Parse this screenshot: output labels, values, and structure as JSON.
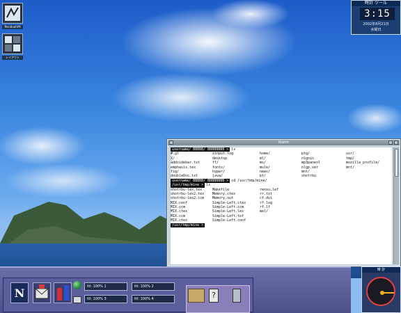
{
  "desktop": {
    "pager_icon_label": "ResidualVM",
    "layout_icon_label": "レイアウト"
  },
  "clock": {
    "title": "時計 ツール",
    "time": "3:15",
    "date": "2002年8月21日",
    "day": "水曜日"
  },
  "terminal": {
    "title": "kterm",
    "lines": [
      {
        "prompt": "username/ BBBBB/ BBBBBBBB >",
        "cmd": "ls",
        "cells": []
      },
      {
        "prompt": "",
        "cmd": "",
        "cells": [
          "#.gl",
          "xinput.log",
          "home/",
          "ptg/",
          "usr/"
        ]
      },
      {
        "prompt": "",
        "cmd": "",
        "cells": [
          "X/",
          "desktop",
          "ml/",
          "nlgnin",
          "tmp/"
        ]
      },
      {
        "prompt": "",
        "cmd": "",
        "cells": [
          "addsidebar.txt",
          "ff/",
          "ms/",
          "mp3paneol",
          "mozilla_profile/"
        ]
      },
      {
        "prompt": "",
        "cmd": "",
        "cells": [
          "emphasis.tex",
          "fonts/",
          "mule/",
          "nlgp.ver",
          "mnt/"
        ]
      },
      {
        "prompt": "",
        "cmd": "",
        "cells": [
          "fig/",
          "hyper/",
          "news/",
          "mnt/",
          ""
        ]
      },
      {
        "prompt": "",
        "cmd": "",
        "cells": [
          "doubleDoc.txt",
          "java/",
          "pt/",
          "shotrbu",
          ""
        ]
      },
      {
        "prompt": "username/ BBBBB/ BBBBBBBB >",
        "cmd": "cd /usr/tmp/mine/",
        "cells": []
      },
      {
        "prompt": "/usr/tmp/mine >",
        "cmd": "ls",
        "cells": []
      },
      {
        "prompt": "",
        "cmd": "",
        "cells": [
          "shotrbu-lex.tex",
          "Makefile",
          "rensu.lef",
          ""
        ]
      },
      {
        "prompt": "",
        "cmd": "",
        "cells": [
          "shotrbu-lex2.tex",
          "Memory.ctex",
          "rr.txt",
          ""
        ]
      },
      {
        "prompt": "",
        "cmd": "",
        "cells": [
          "shotrbu-lex2.ccm",
          "Memory.out",
          "cf.dvi",
          ""
        ]
      },
      {
        "prompt": "",
        "cmd": "",
        "cells": [
          "MIX.conf",
          "Simple-Left.ctex",
          "rf.log",
          ""
        ]
      },
      {
        "prompt": "",
        "cmd": "",
        "cells": [
          "MIX.ccm",
          "Simple-Left.ccm",
          "rf.lf",
          ""
        ]
      },
      {
        "prompt": "",
        "cmd": "",
        "cells": [
          "MIX.ctex",
          "Simple-Left.lex",
          "mel/",
          ""
        ]
      },
      {
        "prompt": "",
        "cmd": "",
        "cells": [
          "MIX.ccm",
          "Simple-Left.tof",
          "",
          ""
        ]
      },
      {
        "prompt": "",
        "cmd": "",
        "cells": [
          "MIX.ctex",
          "Simple-Left.conf",
          "",
          ""
        ]
      },
      {
        "prompt": "/usr/tmp/mine >",
        "cmd": "",
        "cells": []
      }
    ]
  },
  "taskbar": {
    "app_n_label": "N",
    "task_buttons": [
      "ttl: 100% 1",
      "ttl: 100% 2",
      "ttl: 100% 3",
      "ttl: 100% 4"
    ],
    "help_label": "?"
  },
  "compass": {
    "title": "時 計"
  },
  "colors": {
    "taskbar": "#5a5f9c",
    "prompt_bg": "#101010",
    "compass_ring": "#e04040"
  }
}
